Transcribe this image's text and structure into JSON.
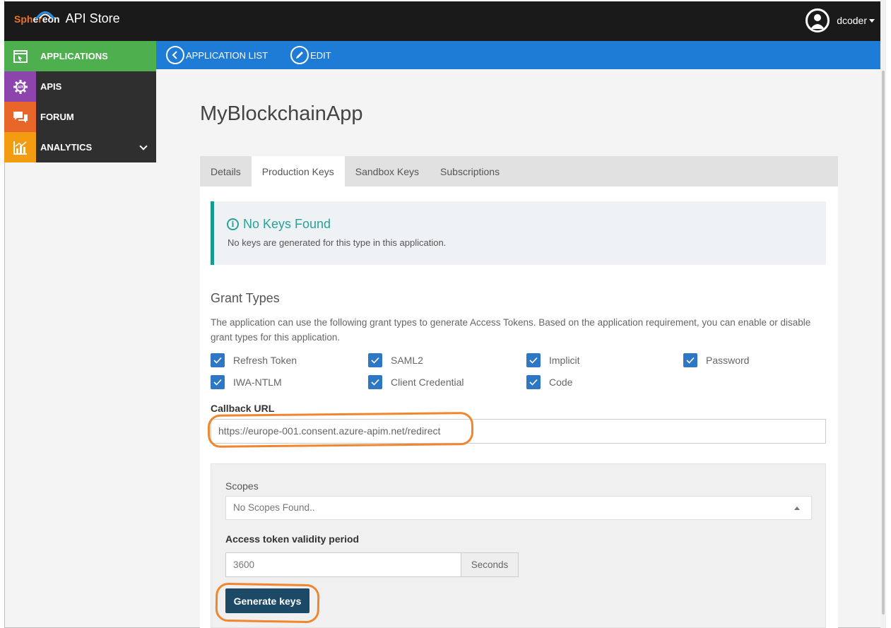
{
  "header": {
    "brand_logo": "Spheron",
    "app_title": "API Store",
    "username": "dcoder"
  },
  "sidebar": {
    "items": [
      {
        "label": "APPLICATIONS",
        "icon": "window-icon",
        "color": "#4eaf4e"
      },
      {
        "label": "APIS",
        "icon": "api-gear-icon",
        "color": "#8e44ad"
      },
      {
        "label": "FORUM",
        "icon": "chat-bubbles-icon",
        "color": "#e8662a"
      },
      {
        "label": "ANALYTICS",
        "icon": "bar-chart-icon",
        "color": "#f39c12"
      }
    ]
  },
  "toolbar": {
    "back_label": "APPLICATION LIST",
    "edit_label": "EDIT",
    "color": "#1e7bd6"
  },
  "main": {
    "title": "MyBlockchainApp",
    "tabs": [
      {
        "label": "Details",
        "active": false
      },
      {
        "label": "Production Keys",
        "active": true
      },
      {
        "label": "Sandbox Keys",
        "active": false
      },
      {
        "label": "Subscriptions",
        "active": false
      }
    ],
    "alert": {
      "title": "No Keys Found",
      "text": "No keys are generated for this type in this application."
    },
    "grant_types": {
      "title": "Grant Types",
      "description": "The application can use the following grant types to generate Access Tokens. Based on the application requirement, you can enable or disable grant types for this application.",
      "options": [
        {
          "label": "Refresh Token",
          "checked": true
        },
        {
          "label": "SAML2",
          "checked": true
        },
        {
          "label": "Implicit",
          "checked": true
        },
        {
          "label": "Password",
          "checked": true
        },
        {
          "label": "IWA-NTLM",
          "checked": true
        },
        {
          "label": "Client Credential",
          "checked": true
        },
        {
          "label": "Code",
          "checked": true
        }
      ]
    },
    "callback": {
      "label": "Callback URL",
      "value": "https://europe-001.consent.azure-apim.net/redirect"
    },
    "scopes": {
      "label": "Scopes",
      "value": "No Scopes Found.."
    },
    "token_validity": {
      "label": "Access token validity period",
      "value": "3600",
      "unit": "Seconds"
    },
    "generate_label": "Generate keys"
  },
  "highlight_color": "#f0862e"
}
